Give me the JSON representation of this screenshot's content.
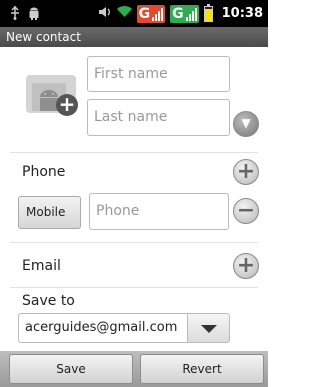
{
  "status_bar": {
    "time": "10:38",
    "icons": [
      "usb-icon",
      "android-debug-icon",
      "volume-icon",
      "wifi-icon",
      "network-g-icon",
      "network-g-icon",
      "battery-icon"
    ],
    "network_label_1": "G",
    "network_label_2": "G",
    "colors": {
      "network_1": "#e8492e",
      "network_2": "#2fae4f",
      "battery_fill": "#f7e200"
    }
  },
  "title": "New contact",
  "name_fields": {
    "first_placeholder": "First name",
    "last_placeholder": "Last name"
  },
  "phone": {
    "label": "Phone",
    "type_label": "Mobile",
    "placeholder": "Phone"
  },
  "email": {
    "label": "Email"
  },
  "save_to": {
    "label": "Save to",
    "account": "acerguides@gmail.com"
  },
  "buttons": {
    "save": "Save",
    "revert": "Revert"
  }
}
